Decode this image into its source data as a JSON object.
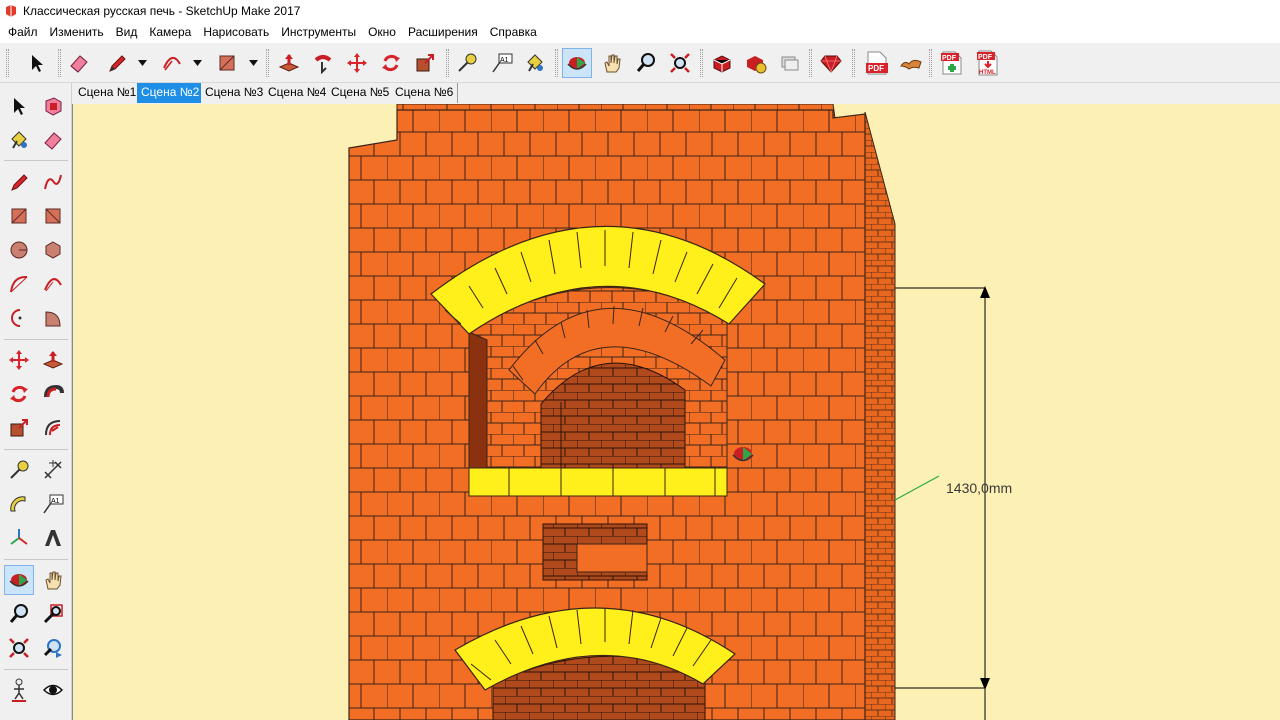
{
  "window": {
    "title": "Классическая русская печь - SketchUp Make 2017"
  },
  "menu": {
    "items": [
      "Файл",
      "Изменить",
      "Вид",
      "Камера",
      "Нарисовать",
      "Инструменты",
      "Окно",
      "Расширения",
      "Справка"
    ]
  },
  "tabs": {
    "items": [
      "Сцена №1",
      "Сцена №2",
      "Сцена №3",
      "Сцена №4",
      "Сцена №5",
      "Сцена №6"
    ],
    "active_index": 1
  },
  "viewport": {
    "dimension_label": "1430,0mm"
  },
  "toolbar": {
    "pdf_label": "PDF",
    "html_label": "HTML",
    "text_tool_label": "A1"
  },
  "colors": {
    "background": "#fdf0b4",
    "brick": "#f26e24",
    "mortar": "#3a2418",
    "arch_brick": "#ffef1a",
    "active_tab": "#1f8ee6",
    "dimension_line": "#000000",
    "guide_green": "#2aa84a"
  },
  "icons": {
    "top_toolbar": [
      "select-icon",
      "eraser-icon",
      "pencil-icon",
      "arc-icon",
      "rectangle-icon",
      "push-pull-icon",
      "follow-me-icon",
      "move-icon",
      "rotate-icon",
      "scale-icon",
      "tape-measure-icon",
      "text-icon",
      "paint-bucket-icon",
      "orbit-icon",
      "pan-icon",
      "zoom-icon",
      "zoom-extents-icon",
      "3d-warehouse-icon",
      "extension-warehouse-icon",
      "layout-icon",
      "ruby-icon",
      "export-pdf-icon",
      "sandbox-icon",
      "pdf-import-icon",
      "pdf-html-icon"
    ],
    "left_toolbar": [
      "select-icon",
      "make-component-icon",
      "paint-bucket-icon",
      "eraser-icon",
      "line-icon",
      "freehand-icon",
      "rectangle-icon",
      "rotated-rectangle-icon",
      "circle-icon",
      "polygon-icon",
      "arc-icon",
      "two-point-arc-icon",
      "three-point-arc-icon",
      "pie-icon",
      "move-icon",
      "push-pull-icon",
      "rotate-icon",
      "follow-me-icon",
      "scale-icon",
      "offset-icon",
      "tape-measure-icon",
      "dimension-icon",
      "protractor-icon",
      "text-icon",
      "axes-icon",
      "3d-text-icon",
      "orbit-icon",
      "pan-icon",
      "zoom-icon",
      "zoom-window-icon",
      "zoom-extents-icon",
      "previous-view-icon",
      "position-camera-icon",
      "look-around-icon"
    ]
  }
}
